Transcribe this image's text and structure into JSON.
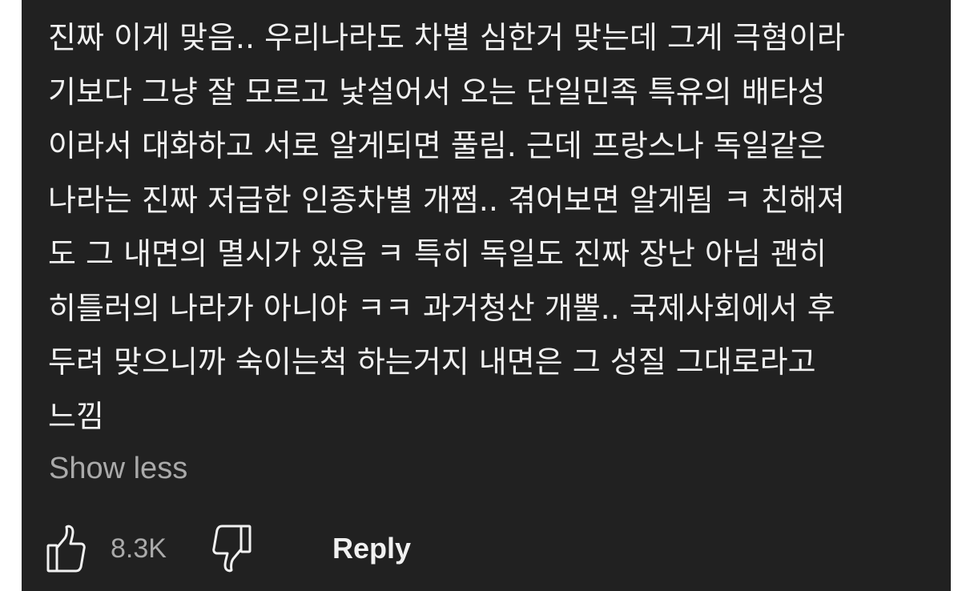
{
  "comment": {
    "lines": [
      "진짜 이게 맞음.. 우리나라도 차별 심한거 맞는데 그게 극혐이라",
      "기보다 그냥 잘 모르고 낯설어서 오는 단일민족 특유의 배타성",
      "이라서 대화하고 서로 알게되면 풀림. 근데 프랑스나 독일같은",
      "나라는 진짜 저급한 인종차별 개쩜.. 겪어보면 알게됨 ㅋ 친해져",
      "도 그 내면의 멸시가 있음 ㅋ 특히 독일도 진짜 장난 아님 괜히",
      "히틀러의 나라가 아니야 ㅋㅋ 과거청산 개뿔.. 국제사회에서 후",
      "두려 맞으니까 숙이는척 하는거지 내면은 그 성질 그대로라고",
      "느낌"
    ],
    "show_less_label": "Show less"
  },
  "actions": {
    "like_icon": "thumbs-up-icon",
    "like_count": "8.3K",
    "dislike_icon": "thumbs-down-icon",
    "reply_label": "Reply"
  },
  "colors": {
    "background": "#212121",
    "text_primary": "#f1f1f1",
    "text_secondary": "#aaaaaa"
  }
}
